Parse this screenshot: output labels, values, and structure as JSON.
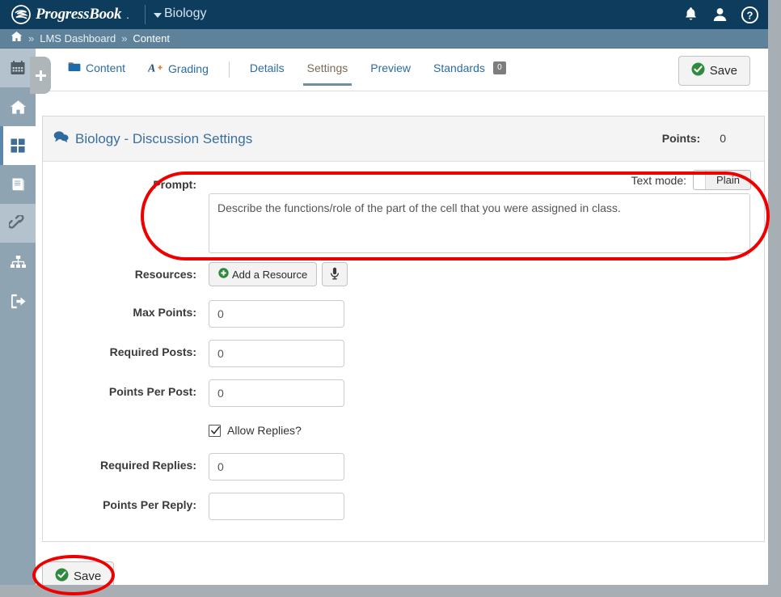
{
  "app": {
    "brand_name": "ProgressBook",
    "course": "Biology",
    "topbar_color": "#0e3c5c",
    "breadcrumb_color": "#5f829b"
  },
  "topbar": {
    "icons": [
      {
        "name": "bell-icon",
        "label": "Notifications"
      },
      {
        "name": "user-icon",
        "label": "Account"
      },
      {
        "name": "help-icon",
        "label": "Help"
      }
    ]
  },
  "breadcrumb": {
    "home_icon": "home-icon",
    "sep": "»",
    "items": [
      {
        "label": "LMS Dashboard"
      },
      {
        "label": "Content"
      }
    ]
  },
  "sidebar": {
    "plus_tab_label": "+",
    "items": [
      {
        "name": "calendar",
        "icon": "calendar-icon",
        "state": "tint"
      },
      {
        "name": "home",
        "icon": "home-icon",
        "state": "normal"
      },
      {
        "name": "dashboard",
        "icon": "grid-icon",
        "state": "active"
      },
      {
        "name": "gradebook",
        "icon": "book-icon",
        "state": "normal"
      },
      {
        "name": "links",
        "icon": "link-icon",
        "state": "tint"
      },
      {
        "name": "hierarchy",
        "icon": "sitemap-icon",
        "state": "normal"
      },
      {
        "name": "signout",
        "icon": "logout-icon",
        "state": "normal"
      }
    ]
  },
  "tabs": [
    {
      "label": "Content",
      "icon": "folder-icon",
      "active": false
    },
    {
      "label": "Grading",
      "icon": "grade-a-plus-icon",
      "active": false
    },
    {
      "label": "Details",
      "icon": "",
      "active": false
    },
    {
      "label": "Settings",
      "icon": "",
      "active": true
    },
    {
      "label": "Preview",
      "icon": "",
      "active": false
    },
    {
      "label": "Standards",
      "icon": "",
      "active": false,
      "badge": "0"
    }
  ],
  "toolbar": {
    "save_label": "Save",
    "save_icon": "check-circle-icon"
  },
  "card": {
    "title": "Biology - Discussion Settings",
    "title_icon": "discussion-icon",
    "points_label": "Points:",
    "points_value": "0"
  },
  "form": {
    "prompt": {
      "label": "Prompt:",
      "value": "Describe the functions/role of the part of the cell that you were assigned in class.",
      "placeholder": "",
      "text_mode_label": "Text mode:",
      "text_mode_value": "Plain"
    },
    "resources": {
      "label": "Resources:",
      "add_button_label": "Add a Resource",
      "add_button_icon": "plus-circle-icon",
      "mic_button_icon": "microphone-icon"
    },
    "max_points": {
      "label": "Max Points:",
      "value": "0",
      "placeholder": ""
    },
    "required_posts": {
      "label": "Required Posts:",
      "value": "0",
      "placeholder": ""
    },
    "points_per_post": {
      "label": "Points Per Post:",
      "value": "0",
      "placeholder": ""
    },
    "allow_replies": {
      "label": "Allow Replies?",
      "checked": true
    },
    "required_replies": {
      "label": "Required Replies:",
      "value": "0",
      "placeholder": ""
    },
    "points_per_reply": {
      "label": "Points Per Reply:",
      "value": "",
      "placeholder": ""
    }
  },
  "footer": {
    "save_label": "Save",
    "save_icon": "check-circle-icon"
  },
  "annotations": {
    "color": "#ee0000",
    "shapes": [
      {
        "name": "prompt-highlight",
        "target": "prompt-row"
      },
      {
        "name": "save-highlight",
        "target": "save-bottom"
      }
    ]
  }
}
